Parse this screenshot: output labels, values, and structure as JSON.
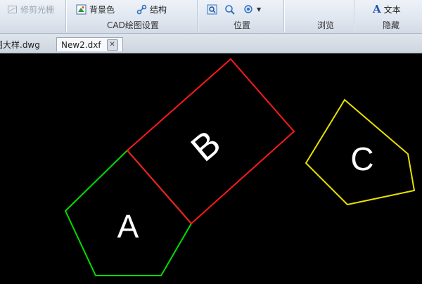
{
  "ribbon": {
    "buttons": {
      "trim": "修剪光栅",
      "background": "背景色",
      "structure": "结构",
      "text": "文本"
    },
    "groups": {
      "cad_settings": "CAD绘图设置",
      "position": "位置",
      "browse": "浏览",
      "hide": "隐藏"
    }
  },
  "tabs": [
    {
      "label": "图大样.dwg",
      "active": false
    },
    {
      "label": "New2.dxf",
      "active": true
    }
  ],
  "drawing": {
    "labels": {
      "a": "A",
      "b": "B",
      "c": "C"
    },
    "colors": {
      "a": "#00dd00",
      "b": "#ff1a1a",
      "c": "#e8e000",
      "text": "#ffffff"
    }
  },
  "colors": {
    "ribbon": "#dfe6ef",
    "canvas": "#000000"
  }
}
